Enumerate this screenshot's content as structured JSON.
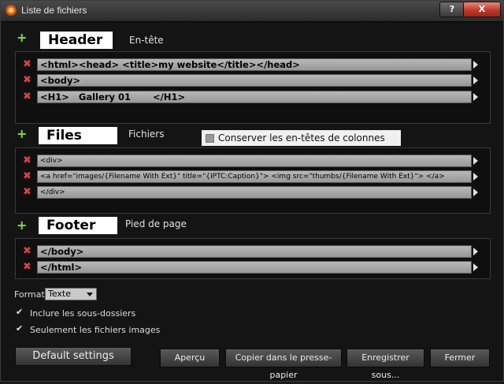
{
  "window": {
    "title": "Liste de fichiers",
    "help_label": "?",
    "close_label": "X"
  },
  "header": {
    "title": "Header",
    "subtitle": "En-tête",
    "rows": [
      "<html><head> <title>my website</title></head>",
      "<body>",
      "<H1>   Gallery 01       </H1>"
    ]
  },
  "files": {
    "title": "Files",
    "subtitle": "Fichiers",
    "keep_headers_label": "Conserver les en-têtes de colonnes",
    "rows": [
      "<div>",
      "<a href=\"images/{Filename With Ext}\" title=\"{IPTC:Caption}\"> <img src=\"thumbs/{Filename With Ext}\"> </a>",
      "</div>"
    ]
  },
  "footer": {
    "title": "Footer",
    "subtitle": "Pied de page",
    "rows": [
      "</body>",
      "</html>"
    ]
  },
  "options": {
    "format_label": "Format",
    "format_value": "Texte",
    "include_subfolders": "Inclure les sous-dossiers",
    "images_only": "Seulement les fichiers images"
  },
  "buttons": {
    "default_settings": "Default settings",
    "preview": "Aperçu",
    "copy_clipboard": "Copier dans le presse-papier",
    "save_as": "Enregistrer sous...",
    "close": "Fermer"
  },
  "icons": {
    "add": "plus-icon",
    "remove": "delete-x-icon",
    "expand": "arrow-right-icon",
    "check": "checkmark-icon"
  },
  "colors": {
    "add": "#7fe04a",
    "remove": "#e04040",
    "close_button": "#c0392b"
  }
}
